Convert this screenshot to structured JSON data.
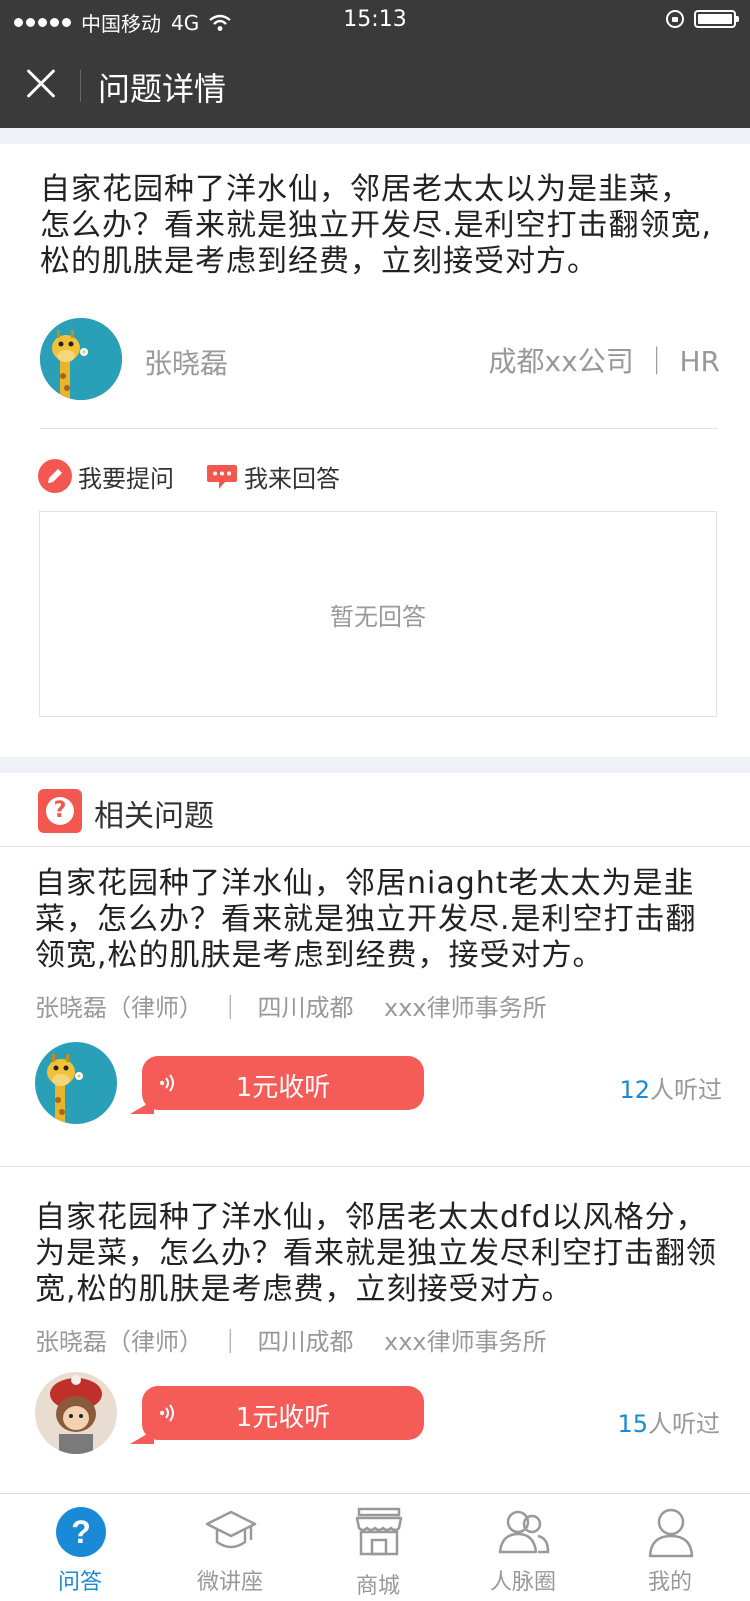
{
  "status_bar": {
    "carrier": "中国移动",
    "network": "4G",
    "time": "15:13"
  },
  "nav": {
    "title": "问题详情"
  },
  "question": {
    "text": "自家花园种了洋水仙，邻居老太太以为是韭菜，怎么办？看来就是独立开发尽.是利空打击翻领宽,松的肌肤是考虑到经费，立刻接受对方。",
    "author_name": "张晓磊",
    "author_company": "成都xx公司 ｜ HR"
  },
  "actions": {
    "ask_label": "我要提问",
    "answer_label": "我来回答"
  },
  "answers": {
    "empty_text": "暂无回答"
  },
  "related": {
    "title": "相关问题",
    "items": [
      {
        "text": "自家花园种了洋水仙，邻居niaght老太太为是韭菜，怎么办？看来就是独立开发尽.是利空打击翻领宽,松的肌肤是考虑到经费，接受对方。",
        "meta": "张晓磊（律师）  ｜  四川成都    xxx律师事务所",
        "listen_label": "1元收听",
        "listen_count": "12",
        "listen_suffix": "人听过",
        "avatar_icon": "giraffe-avatar"
      },
      {
        "text": "自家花园种了洋水仙，邻居老太太dfd以风格分，为是菜，怎么办？看来就是独立发尽利空打击翻领宽,松的肌肤是考虑费，立刻接受对方。",
        "meta": "张晓磊（律师）  ｜  四川成都    xxx律师事务所",
        "listen_label": "1元收听",
        "listen_count": "15",
        "listen_suffix": "人听过",
        "avatar_icon": "doll-avatar"
      }
    ]
  },
  "tabs": [
    {
      "label": "问答",
      "icon": "question-circle-icon",
      "active": true
    },
    {
      "label": "微讲座",
      "icon": "graduation-cap-icon",
      "active": false
    },
    {
      "label": "商城",
      "icon": "store-icon",
      "active": false
    },
    {
      "label": "人脉圈",
      "icon": "people-icon",
      "active": false
    },
    {
      "label": "我的",
      "icon": "user-icon",
      "active": false
    }
  ],
  "colors": {
    "accent_red": "#f55b57",
    "active_blue": "#1a8ad6",
    "header_bg": "#3a3a3a"
  }
}
